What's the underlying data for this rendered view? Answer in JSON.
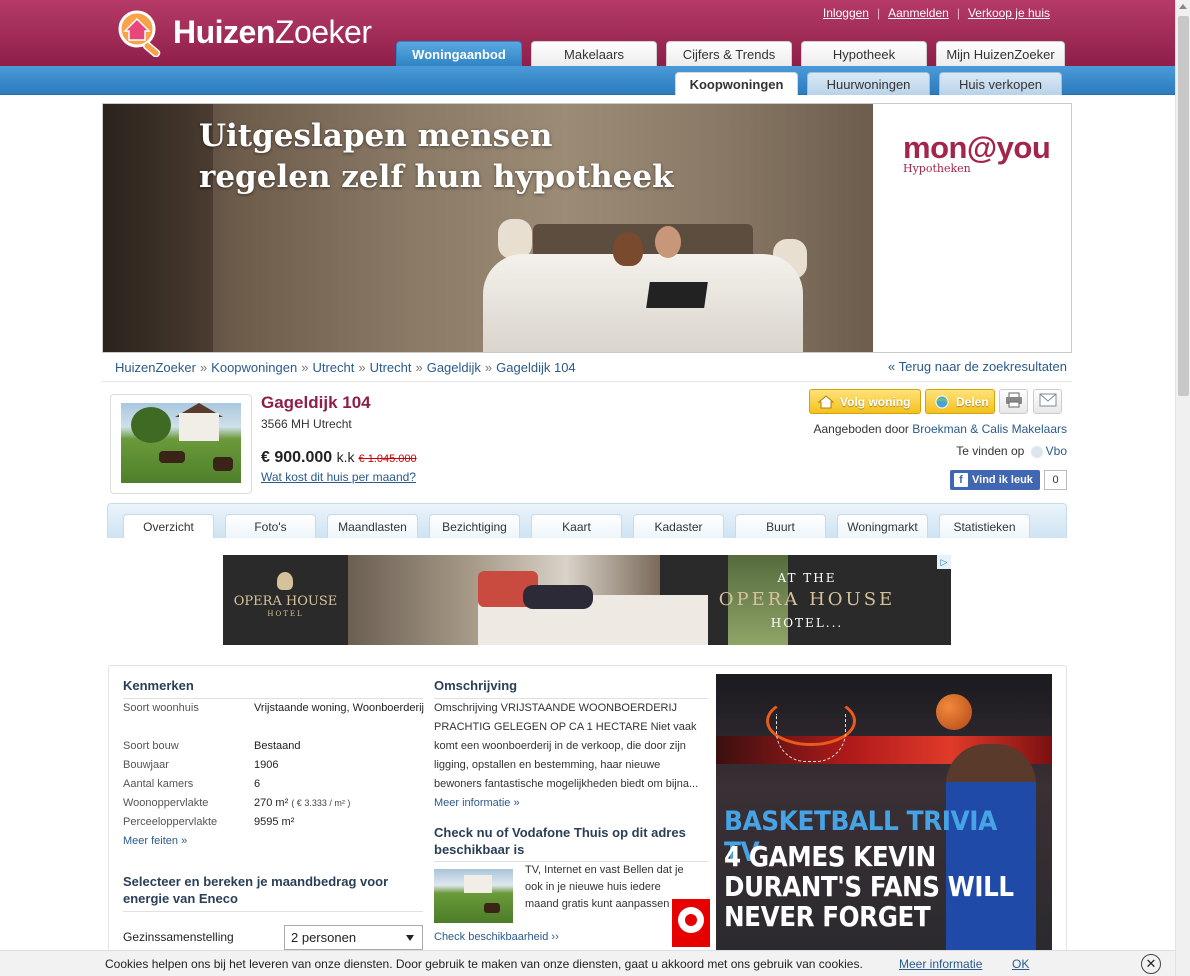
{
  "header": {
    "logo_bold": "Huizen",
    "logo_light": "Zoeker",
    "top_links": [
      "Inloggen",
      "Aanmelden",
      "Verkoop je huis"
    ],
    "main_tabs": [
      "Woningaanbod",
      "Makelaars",
      "Cijfers & Trends",
      "Hypotheek",
      "Mijn HuizenZoeker"
    ],
    "main_tab_active": "Woningaanbod",
    "sub_tabs": [
      "Koopwoningen",
      "Huurwoningen",
      "Huis verkopen"
    ],
    "sub_tab_active": "Koopwoningen"
  },
  "banner": {
    "headline_1": "Uitgeslapen mensen",
    "headline_2": "regelen zelf hun hypotheek",
    "brand": "mon@you",
    "brand_sub": "Hypotheken"
  },
  "breadcrumb": [
    "HuizenZoeker",
    "Koopwoningen",
    "Utrecht",
    "Utrecht",
    "Gageldijk",
    "Gageldijk 104"
  ],
  "back_link": "« Terug naar de zoekresultaten",
  "listing": {
    "title": "Gageldijk 104",
    "address": "3566 MH Utrecht",
    "price": "€ 900.000",
    "price_suffix": "k.k",
    "old_price": "€ 1.045.000",
    "monthly_link": "Wat kost dit huis per maand?",
    "follow_label": "Volg woning",
    "share_label": "Delen",
    "offered_prefix": "Aangeboden door",
    "agent": "Broekman & Calis Makelaars",
    "found_prefix": "Te vinden op",
    "found_source": "Vbo",
    "fb_label": "Vind ik leuk",
    "fb_count": "0"
  },
  "detail_tabs": [
    "Overzicht",
    "Foto's",
    "Maandlasten",
    "Bezichtiging",
    "Kaart",
    "Kadaster",
    "Buurt",
    "Woningmarkt",
    "Statistieken"
  ],
  "detail_tab_active": "Overzicht",
  "opera_ad": {
    "logo_name": "OPERA HOUSE",
    "logo_sub": "HOTEL",
    "line1": "AT THE",
    "line2": "OPERA HOUSE",
    "line3": "HOTEL..."
  },
  "kenmerken": {
    "title": "Kenmerken",
    "rows": [
      {
        "label": "Soort woonhuis",
        "value": "Vrijstaande woning, Woonboerderij"
      },
      {
        "label": "Soort bouw",
        "value": "Bestaand"
      },
      {
        "label": "Bouwjaar",
        "value": "1906"
      },
      {
        "label": "Aantal kamers",
        "value": "6"
      },
      {
        "label": "Woonoppervlakte",
        "value": "270 m²",
        "extra": "( € 3.333 / m² )"
      },
      {
        "label": "Perceeloppervlakte",
        "value": "9595 m²"
      }
    ],
    "more_link": "Meer feiten »"
  },
  "energy": {
    "title": "Selecteer en bereken je maandbedrag voor energie van Eneco",
    "household_label": "Gezinssamenstelling",
    "household_value": "2 personen"
  },
  "description": {
    "title": "Omschrijving",
    "text": "Omschrijving VRIJSTAANDE WOONBOERDERIJ PRACHTIG GELEGEN OP CA 1 HECTARE Niet vaak komt een woonboerderij in de verkoop, die door zijn ligging, opstallen en bestemming, haar nieuwe bewoners fantastische mogelijkheden biedt om bijna...",
    "more_link": "Meer informatie »"
  },
  "vodafone": {
    "title": "Check nu of Vodafone Thuis op dit adres beschikbaar is",
    "text": "TV, Internet en vast Bellen dat je ook in je nieuwe huis iedere maand gratis kunt aanpassen",
    "link": "Check beschikbaarheid ››"
  },
  "bball_ad": {
    "line1": "BASKETBALL TRIVIA TV",
    "line2": "4 GAMES KEVIN DURANT'S FANS WILL NEVER FORGET"
  },
  "cookie": {
    "text": "Cookies helpen ons bij het leveren van onze diensten. Door gebruik te maken van onze diensten, gaat u akkoord met ons gebruik van cookies.",
    "more": "Meer informatie",
    "ok": "OK",
    "close": "✕"
  },
  "colors": {
    "brand_magenta": "#8e1f4a",
    "nav_blue": "#2f84c4",
    "link_blue": "#2a5a8c",
    "button_yellow": "#f4c21d"
  }
}
